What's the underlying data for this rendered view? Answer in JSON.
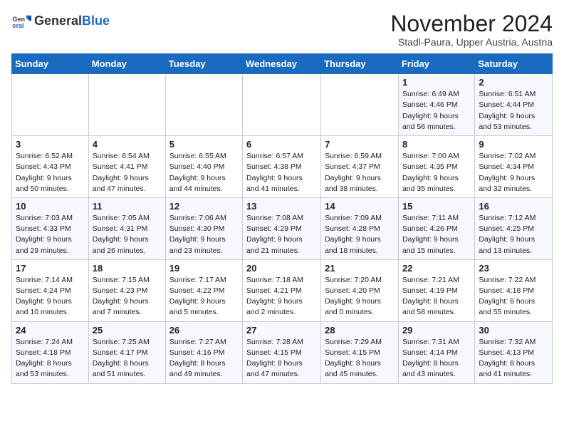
{
  "logo": {
    "general": "General",
    "blue": "Blue"
  },
  "header": {
    "month": "November 2024",
    "location": "Stadl-Paura, Upper Austria, Austria"
  },
  "days_of_week": [
    "Sunday",
    "Monday",
    "Tuesday",
    "Wednesday",
    "Thursday",
    "Friday",
    "Saturday"
  ],
  "weeks": [
    [
      {
        "num": "",
        "info": ""
      },
      {
        "num": "",
        "info": ""
      },
      {
        "num": "",
        "info": ""
      },
      {
        "num": "",
        "info": ""
      },
      {
        "num": "",
        "info": ""
      },
      {
        "num": "1",
        "info": "Sunrise: 6:49 AM\nSunset: 4:46 PM\nDaylight: 9 hours and 56 minutes."
      },
      {
        "num": "2",
        "info": "Sunrise: 6:51 AM\nSunset: 4:44 PM\nDaylight: 9 hours and 53 minutes."
      }
    ],
    [
      {
        "num": "3",
        "info": "Sunrise: 6:52 AM\nSunset: 4:43 PM\nDaylight: 9 hours and 50 minutes."
      },
      {
        "num": "4",
        "info": "Sunrise: 6:54 AM\nSunset: 4:41 PM\nDaylight: 9 hours and 47 minutes."
      },
      {
        "num": "5",
        "info": "Sunrise: 6:55 AM\nSunset: 4:40 PM\nDaylight: 9 hours and 44 minutes."
      },
      {
        "num": "6",
        "info": "Sunrise: 6:57 AM\nSunset: 4:38 PM\nDaylight: 9 hours and 41 minutes."
      },
      {
        "num": "7",
        "info": "Sunrise: 6:59 AM\nSunset: 4:37 PM\nDaylight: 9 hours and 38 minutes."
      },
      {
        "num": "8",
        "info": "Sunrise: 7:00 AM\nSunset: 4:35 PM\nDaylight: 9 hours and 35 minutes."
      },
      {
        "num": "9",
        "info": "Sunrise: 7:02 AM\nSunset: 4:34 PM\nDaylight: 9 hours and 32 minutes."
      }
    ],
    [
      {
        "num": "10",
        "info": "Sunrise: 7:03 AM\nSunset: 4:33 PM\nDaylight: 9 hours and 29 minutes."
      },
      {
        "num": "11",
        "info": "Sunrise: 7:05 AM\nSunset: 4:31 PM\nDaylight: 9 hours and 26 minutes."
      },
      {
        "num": "12",
        "info": "Sunrise: 7:06 AM\nSunset: 4:30 PM\nDaylight: 9 hours and 23 minutes."
      },
      {
        "num": "13",
        "info": "Sunrise: 7:08 AM\nSunset: 4:29 PM\nDaylight: 9 hours and 21 minutes."
      },
      {
        "num": "14",
        "info": "Sunrise: 7:09 AM\nSunset: 4:28 PM\nDaylight: 9 hours and 18 minutes."
      },
      {
        "num": "15",
        "info": "Sunrise: 7:11 AM\nSunset: 4:26 PM\nDaylight: 9 hours and 15 minutes."
      },
      {
        "num": "16",
        "info": "Sunrise: 7:12 AM\nSunset: 4:25 PM\nDaylight: 9 hours and 13 minutes."
      }
    ],
    [
      {
        "num": "17",
        "info": "Sunrise: 7:14 AM\nSunset: 4:24 PM\nDaylight: 9 hours and 10 minutes."
      },
      {
        "num": "18",
        "info": "Sunrise: 7:15 AM\nSunset: 4:23 PM\nDaylight: 9 hours and 7 minutes."
      },
      {
        "num": "19",
        "info": "Sunrise: 7:17 AM\nSunset: 4:22 PM\nDaylight: 9 hours and 5 minutes."
      },
      {
        "num": "20",
        "info": "Sunrise: 7:18 AM\nSunset: 4:21 PM\nDaylight: 9 hours and 2 minutes."
      },
      {
        "num": "21",
        "info": "Sunrise: 7:20 AM\nSunset: 4:20 PM\nDaylight: 9 hours and 0 minutes."
      },
      {
        "num": "22",
        "info": "Sunrise: 7:21 AM\nSunset: 4:19 PM\nDaylight: 8 hours and 58 minutes."
      },
      {
        "num": "23",
        "info": "Sunrise: 7:22 AM\nSunset: 4:18 PM\nDaylight: 8 hours and 55 minutes."
      }
    ],
    [
      {
        "num": "24",
        "info": "Sunrise: 7:24 AM\nSunset: 4:18 PM\nDaylight: 8 hours and 53 minutes."
      },
      {
        "num": "25",
        "info": "Sunrise: 7:25 AM\nSunset: 4:17 PM\nDaylight: 8 hours and 51 minutes."
      },
      {
        "num": "26",
        "info": "Sunrise: 7:27 AM\nSunset: 4:16 PM\nDaylight: 8 hours and 49 minutes."
      },
      {
        "num": "27",
        "info": "Sunrise: 7:28 AM\nSunset: 4:15 PM\nDaylight: 8 hours and 47 minutes."
      },
      {
        "num": "28",
        "info": "Sunrise: 7:29 AM\nSunset: 4:15 PM\nDaylight: 8 hours and 45 minutes."
      },
      {
        "num": "29",
        "info": "Sunrise: 7:31 AM\nSunset: 4:14 PM\nDaylight: 8 hours and 43 minutes."
      },
      {
        "num": "30",
        "info": "Sunrise: 7:32 AM\nSunset: 4:13 PM\nDaylight: 8 hours and 41 minutes."
      }
    ]
  ]
}
